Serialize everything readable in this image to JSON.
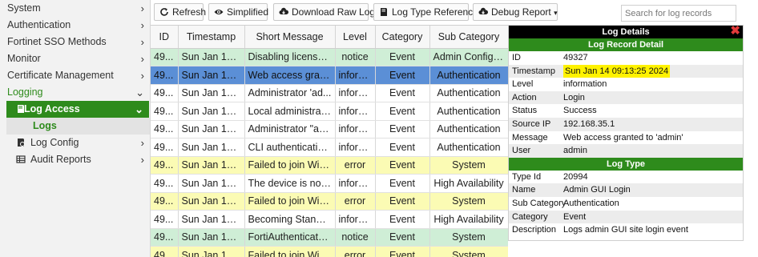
{
  "sidebar": {
    "items": [
      {
        "label": "System"
      },
      {
        "label": "Authentication"
      },
      {
        "label": "Fortinet SSO Methods"
      },
      {
        "label": "Monitor"
      },
      {
        "label": "Certificate Management"
      },
      {
        "label": "Logging"
      },
      {
        "label": "Log Access"
      },
      {
        "label": "Logs"
      },
      {
        "label": "Log Config"
      },
      {
        "label": "Audit Reports"
      }
    ]
  },
  "toolbar": {
    "refresh_label": "Refresh",
    "simplified_label": "Simplified",
    "download_label": "Download Raw Log",
    "log_type_label": "Log Type Reference",
    "debug_label": "Debug Report",
    "search_placeholder": "Search for log records"
  },
  "table": {
    "columns": [
      "ID",
      "Timestamp",
      "Short Message",
      "Level",
      "Category",
      "Sub Category"
    ],
    "rows": [
      {
        "id": "49...",
        "ts": "Sun Jan 14 0...",
        "msg": "Disabling license b...",
        "level": "notice",
        "cat": "Event",
        "sub": "Admin Configura...",
        "style": "notice"
      },
      {
        "id": "49...",
        "ts": "Sun Jan 14 0...",
        "msg": "Web access grant...",
        "level": "inform...",
        "cat": "Event",
        "sub": "Authentication",
        "style": "selected"
      },
      {
        "id": "49...",
        "ts": "Sun Jan 14 0...",
        "msg": "Administrator 'ad...",
        "level": "inform...",
        "cat": "Event",
        "sub": "Authentication",
        "style": "info"
      },
      {
        "id": "49...",
        "ts": "Sun Jan 14 0...",
        "msg": "Local administrato...",
        "level": "inform...",
        "cat": "Event",
        "sub": "Authentication",
        "style": "info"
      },
      {
        "id": "49...",
        "ts": "Sun Jan 14 0...",
        "msg": "Administrator \"ad...",
        "level": "inform...",
        "cat": "Event",
        "sub": "Authentication",
        "style": "info"
      },
      {
        "id": "49...",
        "ts": "Sun Jan 14 0...",
        "msg": "CLI authentication...",
        "level": "inform...",
        "cat": "Event",
        "sub": "Authentication",
        "style": "info"
      },
      {
        "id": "49...",
        "ts": "Sun Jan 14 0...",
        "msg": "Failed to join Win...",
        "level": "error",
        "cat": "Event",
        "sub": "System",
        "style": "error"
      },
      {
        "id": "49...",
        "ts": "Sun Jan 14 0...",
        "msg": "The device is now ...",
        "level": "inform...",
        "cat": "Event",
        "sub": "High Availability",
        "style": "info"
      },
      {
        "id": "49...",
        "ts": "Sun Jan 14 0...",
        "msg": "Failed to join Win...",
        "level": "error",
        "cat": "Event",
        "sub": "System",
        "style": "error"
      },
      {
        "id": "49...",
        "ts": "Sun Jan 14 0...",
        "msg": "Becoming Standal...",
        "level": "inform...",
        "cat": "Event",
        "sub": "High Availability",
        "style": "info"
      },
      {
        "id": "49...",
        "ts": "Sun Jan 14 0...",
        "msg": "FortiAuthenticato...",
        "level": "notice",
        "cat": "Event",
        "sub": "System",
        "style": "notice"
      },
      {
        "id": "49...",
        "ts": "Sun Jan 14 0...",
        "msg": "Failed to join Win...",
        "level": "error",
        "cat": "Event",
        "sub": "System",
        "style": "error"
      }
    ]
  },
  "details": {
    "title": "Log Details",
    "close_glyph": "✖",
    "record_header": "Log Record Detail",
    "record": [
      {
        "label": "ID",
        "value": "49327"
      },
      {
        "label": "Timestamp",
        "value": "Sun Jan 14 09:13:25 2024",
        "highlight": true
      },
      {
        "label": "Level",
        "value": "information"
      },
      {
        "label": "Action",
        "value": "Login"
      },
      {
        "label": "Status",
        "value": "Success"
      },
      {
        "label": "Source IP",
        "value": "192.168.35.1"
      },
      {
        "label": "Message",
        "value": "Web access granted to 'admin'"
      },
      {
        "label": "User",
        "value": "admin"
      }
    ],
    "type_header": "Log Type",
    "type": [
      {
        "label": "Type Id",
        "value": "20994"
      },
      {
        "label": "Name",
        "value": "Admin GUI Login"
      },
      {
        "label": "Sub Category",
        "value": "Authentication"
      },
      {
        "label": "Category",
        "value": "Event"
      },
      {
        "label": "Description",
        "value": "Logs admin GUI site login event"
      }
    ]
  },
  "colors": {
    "brand_green": "#2e8b1c",
    "selected_row": "#5b8fd6",
    "notice_row": "#cfeed6",
    "error_row": "#fbfbb4",
    "highlight": "#fff200"
  }
}
